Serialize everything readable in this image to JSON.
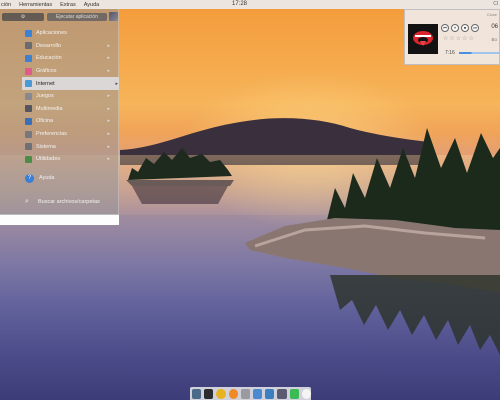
{
  "top_panel": {
    "menu": [
      "ción",
      "Herramientas",
      "Extras",
      "Ayuda"
    ],
    "clock": "17:28",
    "right_text": "Cl"
  },
  "app_menu": {
    "settings_button": "",
    "search_button": "Ejecutar aplicación",
    "categories": [
      {
        "label": "Aplicaciones",
        "icon": "applications-icon",
        "color": "#3b82d6",
        "has_arrow": false
      },
      {
        "label": "Desarrollo",
        "icon": "development-icon",
        "color": "#6a6a70",
        "has_arrow": true
      },
      {
        "label": "Educación",
        "icon": "education-icon",
        "color": "#3f7fd0",
        "has_arrow": true
      },
      {
        "label": "Gráficos",
        "icon": "graphics-icon",
        "color": "#e05a8a",
        "has_arrow": true
      },
      {
        "label": "Internet",
        "icon": "internet-icon",
        "color": "#4b9ad8",
        "has_arrow": true,
        "active": true
      },
      {
        "label": "Juegos",
        "icon": "games-icon",
        "color": "#888890",
        "has_arrow": true
      },
      {
        "label": "Multimedia",
        "icon": "multimedia-icon",
        "color": "#555560",
        "has_arrow": true
      },
      {
        "label": "Oficina",
        "icon": "office-icon",
        "color": "#3a6fb8",
        "has_arrow": true
      },
      {
        "label": "Preferencias",
        "icon": "preferences-icon",
        "color": "#777780",
        "has_arrow": true
      },
      {
        "label": "Sistema",
        "icon": "system-icon",
        "color": "#6f6f78",
        "has_arrow": true
      },
      {
        "label": "Utilidades",
        "icon": "utilities-icon",
        "color": "#4c8c4a",
        "has_arrow": true
      }
    ],
    "help_label": "Ayuda",
    "search_label": "Buscar archivos/carpetas"
  },
  "music_player": {
    "track_number": "06",
    "sub_text": "Bo",
    "elapsed": "7:16",
    "close": "Close",
    "rating_stars": "☆☆☆☆☆",
    "progress": 0.3,
    "controls": [
      "⏮",
      "⏸",
      "⏹",
      "⏭"
    ]
  },
  "dock": {
    "icons": [
      {
        "name": "file-manager-icon",
        "color": "#4b6a8a"
      },
      {
        "name": "terminal-icon",
        "color": "#2b2b30"
      },
      {
        "name": "chrome-icon",
        "color": "#e8b320"
      },
      {
        "name": "firefox-icon",
        "color": "#f08a24"
      },
      {
        "name": "gear-icon",
        "color": "#9a9aa0"
      },
      {
        "name": "file-icon",
        "color": "#4b8ad0"
      },
      {
        "name": "monitor-icon",
        "color": "#3c7fc0"
      },
      {
        "name": "box-icon",
        "color": "#5a5a70"
      },
      {
        "name": "gamepad-icon",
        "color": "#3cba54"
      },
      {
        "name": "clock-icon",
        "color": "#f4f4f4"
      }
    ]
  }
}
